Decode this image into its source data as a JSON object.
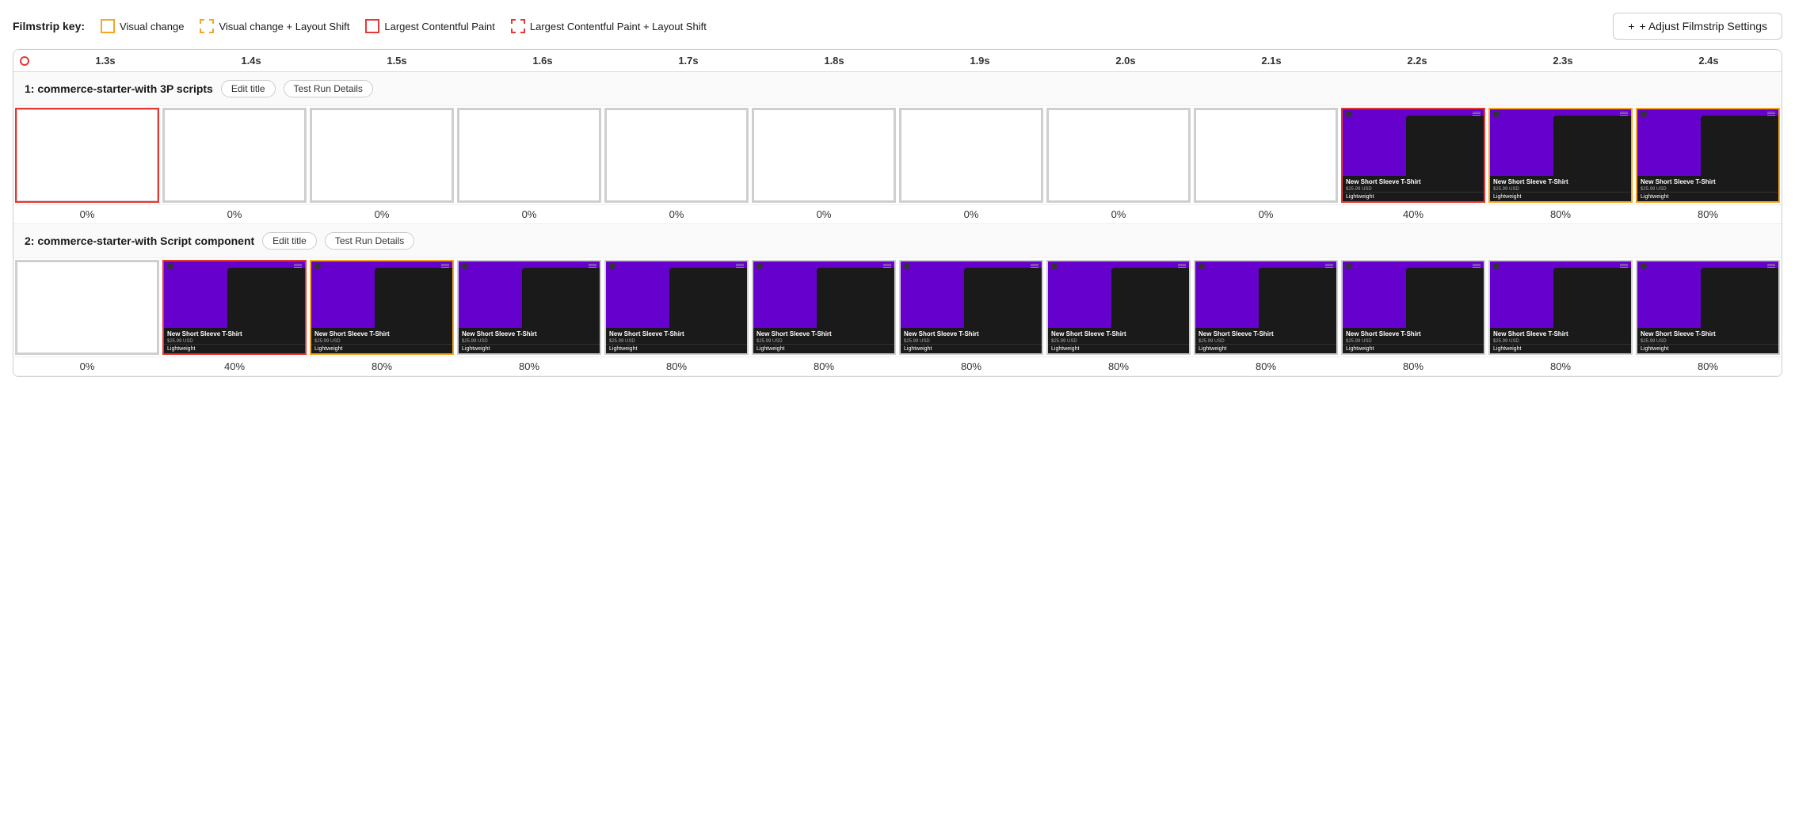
{
  "key": {
    "label": "Filmstrip key:",
    "items": [
      {
        "id": "visual-change",
        "style": "solid-yellow",
        "text": "Visual change"
      },
      {
        "id": "visual-change-layout-shift",
        "style": "dashed-yellow",
        "text": "Visual change + Layout Shift"
      },
      {
        "id": "lcp",
        "style": "solid-red",
        "text": "Largest Contentful Paint"
      },
      {
        "id": "lcp-layout-shift",
        "style": "dashed-red",
        "text": "Largest Contentful Paint + Layout Shift"
      }
    ]
  },
  "adjustBtn": "+ Adjust Filmstrip Settings",
  "timeline": {
    "dot": true,
    "ticks": [
      "1.3s",
      "1.4s",
      "1.5s",
      "1.6s",
      "1.7s",
      "1.8s",
      "1.9s",
      "2.0s",
      "2.1s",
      "2.2s",
      "2.3s",
      "2.4s"
    ]
  },
  "sections": [
    {
      "id": "section-1",
      "title": "1: commerce-starter-with 3P scripts",
      "editBtn": "Edit title",
      "detailsBtn": "Test Run Details",
      "frames": [
        {
          "id": "f1-1",
          "borderType": "red-solid",
          "content": "empty",
          "percent": "0%"
        },
        {
          "id": "f1-2",
          "borderType": "none",
          "content": "empty",
          "percent": "0%"
        },
        {
          "id": "f1-3",
          "borderType": "none",
          "content": "empty",
          "percent": "0%"
        },
        {
          "id": "f1-4",
          "borderType": "none",
          "content": "empty",
          "percent": "0%"
        },
        {
          "id": "f1-5",
          "borderType": "none",
          "content": "empty",
          "percent": "0%"
        },
        {
          "id": "f1-6",
          "borderType": "none",
          "content": "empty",
          "percent": "0%"
        },
        {
          "id": "f1-7",
          "borderType": "none",
          "content": "empty",
          "percent": "0%"
        },
        {
          "id": "f1-8",
          "borderType": "none",
          "content": "empty",
          "percent": "0%"
        },
        {
          "id": "f1-9",
          "borderType": "none",
          "content": "empty",
          "percent": "0%"
        },
        {
          "id": "f1-10",
          "borderType": "red-solid",
          "content": "product",
          "percent": "40%"
        },
        {
          "id": "f1-11",
          "borderType": "yellow-solid",
          "content": "product",
          "percent": "80%"
        },
        {
          "id": "f1-12",
          "borderType": "yellow-solid",
          "content": "product",
          "percent": "80%"
        }
      ]
    },
    {
      "id": "section-2",
      "title": "2: commerce-starter-with Script component",
      "editBtn": "Edit title",
      "detailsBtn": "Test Run Details",
      "frames": [
        {
          "id": "f2-1",
          "borderType": "none",
          "content": "empty",
          "percent": "0%"
        },
        {
          "id": "f2-2",
          "borderType": "red-solid",
          "content": "product",
          "percent": "40%"
        },
        {
          "id": "f2-3",
          "borderType": "yellow-solid",
          "content": "product",
          "percent": "80%"
        },
        {
          "id": "f2-4",
          "borderType": "none",
          "content": "product",
          "percent": "80%"
        },
        {
          "id": "f2-5",
          "borderType": "none",
          "content": "product",
          "percent": "80%"
        },
        {
          "id": "f2-6",
          "borderType": "none",
          "content": "product",
          "percent": "80%"
        },
        {
          "id": "f2-7",
          "borderType": "none",
          "content": "product",
          "percent": "80%"
        },
        {
          "id": "f2-8",
          "borderType": "none",
          "content": "product",
          "percent": "80%"
        },
        {
          "id": "f2-9",
          "borderType": "none",
          "content": "product",
          "percent": "80%"
        },
        {
          "id": "f2-10",
          "borderType": "none",
          "content": "product",
          "percent": "80%"
        },
        {
          "id": "f2-11",
          "borderType": "none",
          "content": "product",
          "percent": "80%"
        },
        {
          "id": "f2-12",
          "borderType": "none",
          "content": "product",
          "percent": "80%"
        }
      ]
    }
  ],
  "productCard": {
    "title": "New Short Sleeve T-Shirt",
    "price": "$25.99 USD",
    "tag": "Lightweight"
  }
}
